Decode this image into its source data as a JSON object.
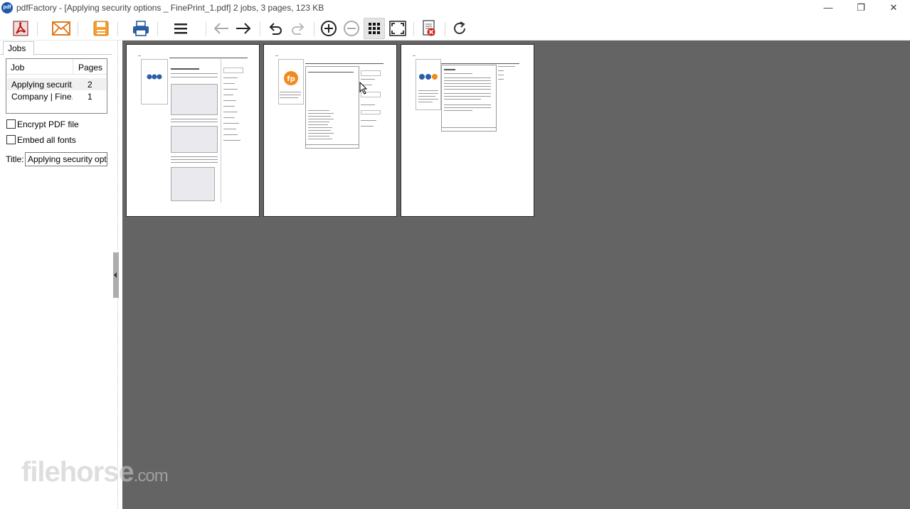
{
  "window": {
    "app_icon_text": "pdf",
    "title": "pdfFactory - [Applying security options _ FinePrint_1.pdf] 2 jobs, 3 pages, 123 KB",
    "controls": {
      "minimize": "—",
      "restore": "❐",
      "close": "✕"
    }
  },
  "toolbar": {
    "buttons": [
      {
        "name": "save-as-pdf",
        "icon": "acrobat-icon"
      },
      {
        "name": "email",
        "icon": "envelope-icon"
      },
      {
        "name": "save",
        "icon": "floppy-disk-icon"
      },
      {
        "name": "print",
        "icon": "printer-icon"
      },
      {
        "name": "menu",
        "icon": "hamburger-menu-icon"
      },
      {
        "name": "previous",
        "icon": "arrow-left-icon"
      },
      {
        "name": "next",
        "icon": "arrow-right-icon"
      },
      {
        "name": "undo",
        "icon": "undo-icon"
      },
      {
        "name": "redo",
        "icon": "redo-icon"
      },
      {
        "name": "zoom-in",
        "icon": "zoom-in-icon"
      },
      {
        "name": "zoom-out",
        "icon": "zoom-out-icon"
      },
      {
        "name": "thumbnails",
        "icon": "grid-icon",
        "active": true
      },
      {
        "name": "fit-page",
        "icon": "fullscreen-icon"
      },
      {
        "name": "delete-pages",
        "icon": "delete-document-icon"
      },
      {
        "name": "refresh",
        "icon": "refresh-icon"
      }
    ]
  },
  "left_panel": {
    "tab": "Jobs",
    "jobs_list": {
      "columns": {
        "job": "Job",
        "pages": "Pages"
      },
      "rows": [
        {
          "job": "Applying securit...",
          "pages": "2",
          "selected": true
        },
        {
          "job": "Company | Fine...",
          "pages": "1",
          "selected": false
        }
      ]
    },
    "options": {
      "encrypt": "Encrypt PDF file",
      "embed_fonts": "Embed all fonts",
      "encrypt_checked": false,
      "embed_fonts_checked": false
    },
    "title_label": "Title:",
    "title_value": "Applying security option"
  },
  "viewer": {
    "page_count": 3,
    "background": "#646464"
  },
  "watermark": {
    "main": "filehorse",
    "suffix": ".com"
  }
}
